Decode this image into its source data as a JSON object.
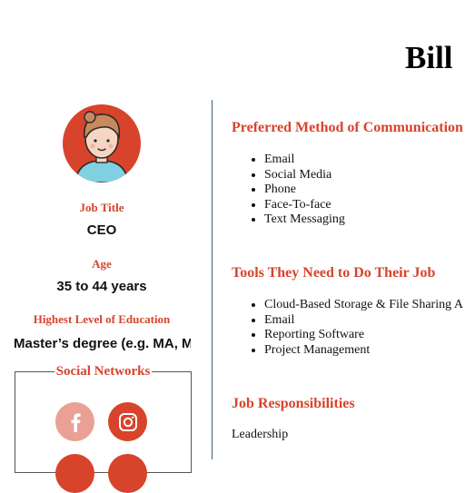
{
  "persona": {
    "name": "Bill"
  },
  "sidebar": {
    "job_title_label": "Job Title",
    "job_title": "CEO",
    "age_label": "Age",
    "age": "35 to 44 years",
    "education_label": "Highest Level of Education",
    "education": "Master’s degree (e.g. MA, MS",
    "social_title": "Social Networks",
    "social_icons": [
      "facebook-icon",
      "instagram-icon"
    ],
    "colors": {
      "accent": "#d8432c",
      "facebook_bg": "#e9a195",
      "instagram_bg": "#d8432c"
    }
  },
  "main": {
    "communication": {
      "title": "Preferred Method of Communication",
      "items": [
        "Email",
        "Social Media",
        "Phone",
        "Face-To-face",
        "Text Messaging"
      ]
    },
    "tools": {
      "title": "Tools They Need to Do Their Job",
      "items": [
        "Cloud-Based Storage & File Sharing A",
        "Email",
        "Reporting Software",
        "Project Management"
      ]
    },
    "responsibilities": {
      "title": "Job Responsibilities",
      "text": "Leadership"
    }
  }
}
